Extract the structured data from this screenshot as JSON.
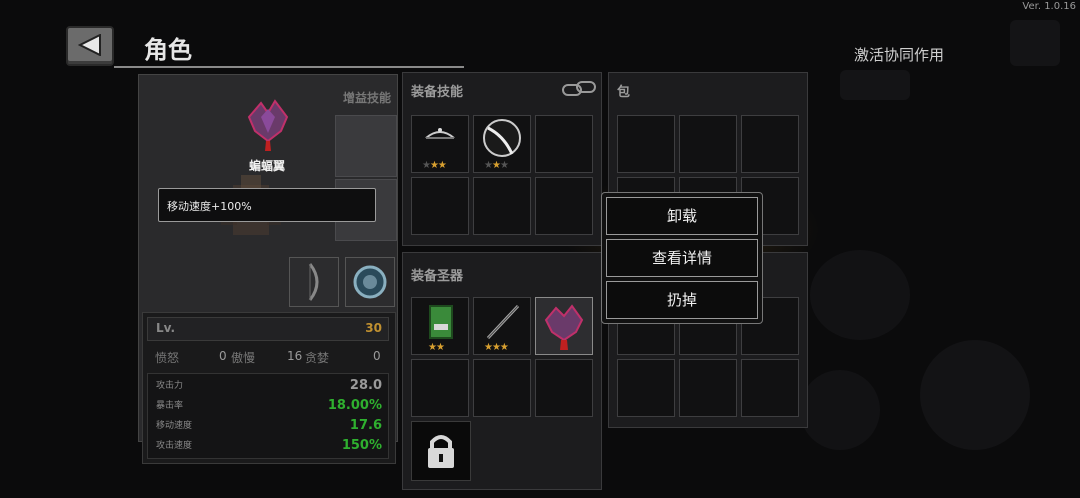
{
  "version": "Ver. 1.0.16",
  "header": {
    "title": "角色",
    "synergy_label": "激活协同作用"
  },
  "character": {
    "bonus_skill_title": "增益技能",
    "item_name": "蝙蝠翼",
    "item_effect": "移动速度+100%"
  },
  "stats": {
    "lv_label": "Lv.",
    "lv_value": "30",
    "sins": [
      {
        "label": "愤怒",
        "value": "0"
      },
      {
        "label": "傲慢",
        "value": "16"
      },
      {
        "label": "贪婪",
        "value": "0"
      }
    ],
    "rows": [
      {
        "label": "攻击力",
        "value": "28.0",
        "color": "#9a9a9a"
      },
      {
        "label": "暴击率",
        "value": "18.00%",
        "color": "#2fb02f"
      },
      {
        "label": "移动速度",
        "value": "17.6",
        "color": "#2fb02f"
      },
      {
        "label": "攻击速度",
        "value": "150%",
        "color": "#2fb02f"
      }
    ]
  },
  "skills_panel": {
    "title": "装备技能",
    "items": [
      {
        "icon": "crossbow-icon",
        "stars": 3
      },
      {
        "icon": "scythe-icon",
        "stars": 2
      }
    ]
  },
  "relics_panel": {
    "title": "装备圣器",
    "items": [
      {
        "icon": "green-monster-icon",
        "stars": 2
      },
      {
        "icon": "staff-icon",
        "stars": 3
      },
      {
        "icon": "bat-wing-icon",
        "stars": 0
      }
    ]
  },
  "bag_panel": {
    "title": "包"
  },
  "context_menu": {
    "unequip": "卸载",
    "details": "查看详情",
    "discard": "扔掉"
  },
  "colors": {
    "accent_gold": "#c09030",
    "green_stat": "#2fb02f",
    "star": "#d8a030"
  }
}
